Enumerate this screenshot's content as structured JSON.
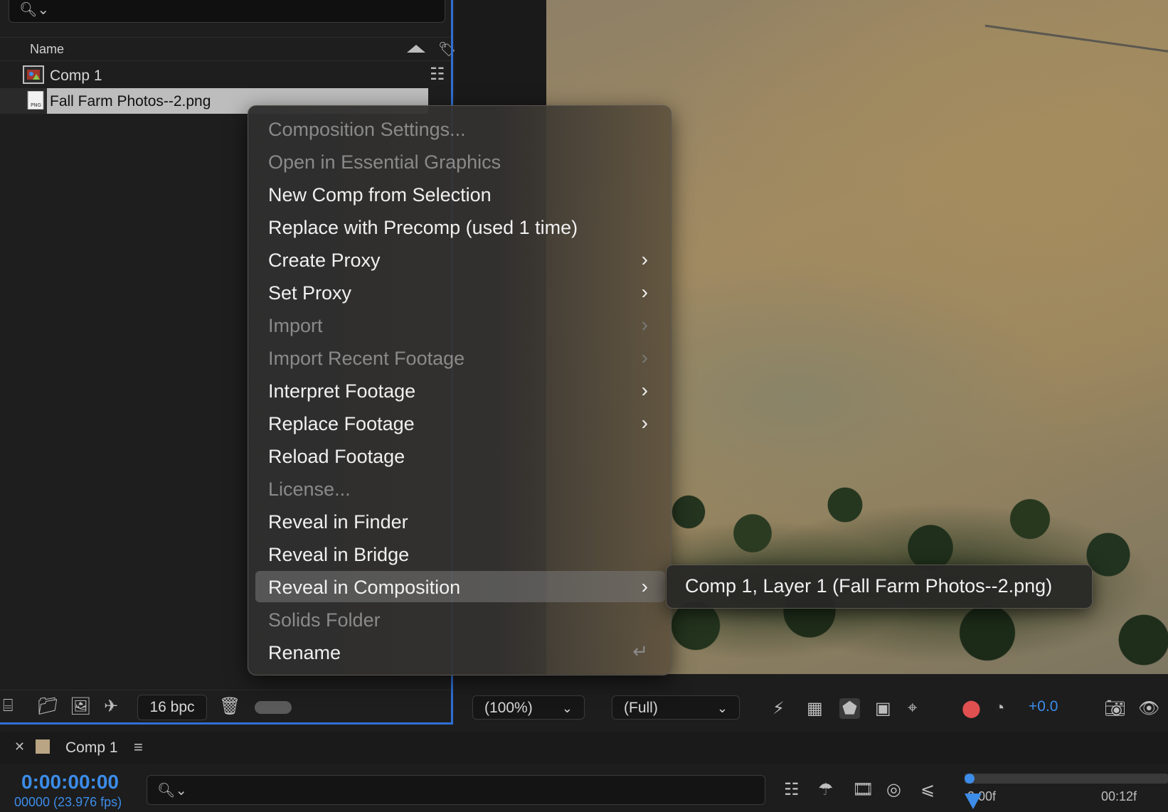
{
  "project": {
    "column_name": "Name",
    "items": [
      {
        "label": "Comp 1"
      },
      {
        "label": "Fall Farm Photos--2.png"
      }
    ],
    "footer": {
      "bpc": "16 bpc"
    }
  },
  "viewer": {
    "zoom": "(100%)",
    "resolution": "(Full)",
    "exposure": "+0.0"
  },
  "timeline": {
    "tab_label": "Comp 1",
    "timecode": "0:00:00:00",
    "frames": "00000 (23.976 fps)",
    "ruler_start": "0:00f",
    "ruler_mark": "00:12f",
    "swatch_color": "#b9a583"
  },
  "context_menu": {
    "items": [
      {
        "label": "Composition Settings...",
        "enabled": false
      },
      {
        "label": "Open in Essential Graphics",
        "enabled": false
      },
      {
        "label": "New Comp from Selection",
        "enabled": true
      },
      {
        "label": "Replace with Precomp (used 1 time)",
        "enabled": true
      },
      {
        "label": "Create Proxy",
        "enabled": true,
        "submenu": true
      },
      {
        "label": "Set Proxy",
        "enabled": true,
        "submenu": true
      },
      {
        "label": "Import",
        "enabled": false,
        "submenu": true
      },
      {
        "label": "Import Recent Footage",
        "enabled": false,
        "submenu": true
      },
      {
        "label": "Interpret Footage",
        "enabled": true,
        "submenu": true
      },
      {
        "label": "Replace Footage",
        "enabled": true,
        "submenu": true
      },
      {
        "label": "Reload Footage",
        "enabled": true
      },
      {
        "label": "License...",
        "enabled": false
      },
      {
        "label": "Reveal in Finder",
        "enabled": true
      },
      {
        "label": "Reveal in Bridge",
        "enabled": true
      },
      {
        "label": "Reveal in Composition",
        "enabled": true,
        "submenu": true,
        "active": true
      },
      {
        "label": "Solids Folder",
        "enabled": false
      },
      {
        "label": "Rename",
        "enabled": true
      }
    ],
    "submenu_item": "Comp 1, Layer 1 (Fall Farm Photos--2.png)"
  },
  "colors": {
    "accent": "#3c8ce8",
    "panel_border": "#2f6fd6"
  }
}
